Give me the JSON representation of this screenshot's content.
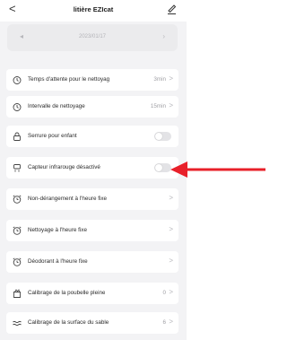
{
  "header": {
    "back_label": "<",
    "title": "litière EZIcat"
  },
  "date_selector": {
    "prev": "◂",
    "date": "2023/01/17",
    "next": "›"
  },
  "settings": [
    {
      "label": "Temps d'attente pour le nettoyag",
      "value": "3min",
      "chevron": ">",
      "icon": "timer-icon"
    },
    {
      "label": "Intervalle de nettoyage",
      "value": "15min",
      "chevron": ">",
      "icon": "timer-icon"
    },
    {
      "label": "Serrure pour enfant",
      "toggle": false,
      "icon": "lock-icon"
    },
    {
      "label": "Capteur infrarouge désactivé",
      "toggle": false,
      "icon": "infrared-sensor-icon"
    },
    {
      "label": "Non-dérangement à l'heure fixe",
      "chevron": ">",
      "icon": "alarm-clock-icon"
    },
    {
      "label": "Nettoyage à l'heure fixe",
      "chevron": ">",
      "icon": "alarm-clock-icon"
    },
    {
      "label": "Déodorant à l'heure fixe",
      "chevron": ">",
      "icon": "alarm-clock-icon"
    },
    {
      "label": "Calibrage de la poubelle pleine",
      "value": "0",
      "chevron": ">",
      "icon": "bin-icon"
    },
    {
      "label": "Calibrage de la surface du sable",
      "value": "6",
      "chevron": ">",
      "icon": "sand-waves-icon"
    }
  ],
  "colors": {
    "annotation_arrow": "#e8202a",
    "background": "#f3f3f5",
    "card": "#ffffff"
  }
}
